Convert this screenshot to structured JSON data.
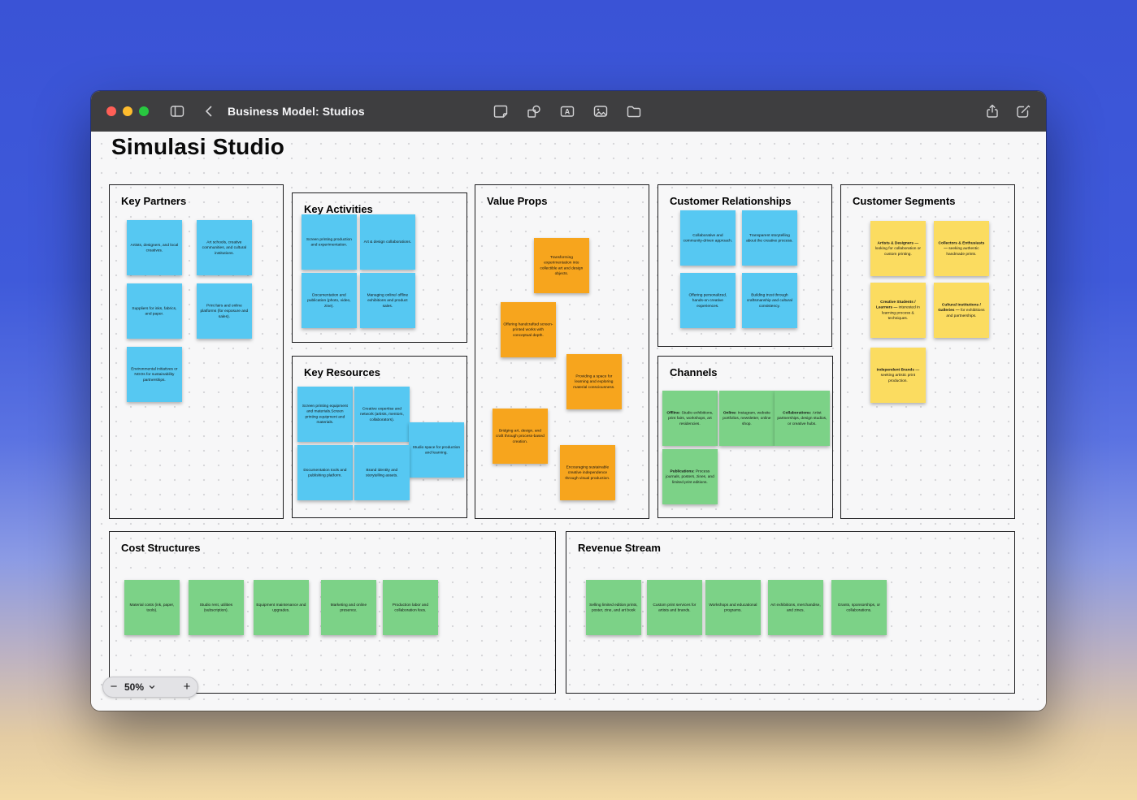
{
  "window": {
    "title": "Business Model: Studios"
  },
  "board": {
    "title": "Simulasi Studio"
  },
  "zoom_control": {
    "decrease_label": "−",
    "level": "50%",
    "increase_label": "+"
  },
  "colors": {
    "note_blue": "#56c8f2",
    "note_orange": "#f7a51d",
    "note_green": "#7cd287",
    "note_yellow": "#fbdc60",
    "traffic_close": "#ff5f57",
    "traffic_min": "#febc2e",
    "traffic_zoom": "#28c840"
  },
  "icons": {
    "zoom_out": "−",
    "zoom_in": "+",
    "zoom_menu_chevron": "⌄"
  },
  "sections": {
    "key_partners": {
      "title": "Key Partners",
      "notes": [
        {
          "color": "blue",
          "text": "Artists, designers, and local creatives."
        },
        {
          "color": "blue",
          "text": "Art schools, creative communities, and cultural institutions."
        },
        {
          "color": "blue",
          "text": "Suppliers for inks, fabrics, and paper."
        },
        {
          "color": "blue",
          "text": "Print fairs and online platforms (for exposure and sales)."
        },
        {
          "color": "blue",
          "text": "Environmental initiatives or NGOs for sustainability partnerships."
        }
      ]
    },
    "key_activities": {
      "title": "Key Activities",
      "notes": [
        {
          "color": "blue",
          "text": "Screen printing production and experimentation."
        },
        {
          "color": "blue",
          "text": "Art & design collaborations."
        },
        {
          "color": "blue",
          "text": "Documentation and publication (photo, video, zine)."
        },
        {
          "color": "blue",
          "text": "Managing online/ offline exhibitions and product sales."
        }
      ]
    },
    "key_resources": {
      "title": "Key Resources",
      "notes": [
        {
          "color": "blue",
          "text": "Screen printing equipment and materials.Screen printing equipment and materials."
        },
        {
          "color": "blue",
          "text": "Creative expertise and network (artists, mentors, collaborators)."
        },
        {
          "color": "blue",
          "text": "Studio space for production and learning."
        },
        {
          "color": "blue",
          "text": "Documentation tools and publishing platform."
        },
        {
          "color": "blue",
          "text": "Brand identity and storytelling assets."
        }
      ]
    },
    "value_props": {
      "title": "Value Props",
      "notes": [
        {
          "color": "orange",
          "text": "Transforming experimentation into collectible art and design objects."
        },
        {
          "color": "orange",
          "text": "Offering handcrafted screen-printed works with conceptual depth."
        },
        {
          "color": "orange",
          "text": "Providing a space for learning and exploring material consciousness."
        },
        {
          "color": "orange",
          "text": "Bridging art, design, and craft through process-based creation."
        },
        {
          "color": "orange",
          "text": "Encouraging sustainable creative independence through visual production."
        }
      ]
    },
    "customer_relationships": {
      "title": "Customer Relationships",
      "notes": [
        {
          "color": "blue",
          "text": "Collaborative and community-driven approach."
        },
        {
          "color": "blue",
          "text": "Transparent storytelling about the creative process."
        },
        {
          "color": "blue",
          "text": "Offering personalized, hands-on creative experiences."
        },
        {
          "color": "blue",
          "text": "Building trust through craftsmanship and cultural consistency."
        }
      ]
    },
    "channels": {
      "title": "Channels",
      "notes": [
        {
          "color": "green",
          "lead": "Offline: ",
          "text": "Studio exhibitions, print fairs, workshops, art residencies."
        },
        {
          "color": "green",
          "lead": "Online: ",
          "text": "Instagram, website portfolios, newsletter, online shop."
        },
        {
          "color": "green",
          "lead": "Collaborations: ",
          "text": "Artist partnerships, design studios, or creative hubs."
        },
        {
          "color": "green",
          "lead": "Publications: ",
          "text": "Process journals, posters, zines, and limited print editions."
        }
      ]
    },
    "customer_segments": {
      "title": "Customer Segments",
      "notes": [
        {
          "color": "yellow",
          "lead": "Artists & Designers — ",
          "text": "looking for collaboration or custom printing."
        },
        {
          "color": "yellow",
          "lead": "Collectors & Enthusiasts — ",
          "text": "seeking authentic handmade prints."
        },
        {
          "color": "yellow",
          "lead": "Creative Students / Learners — ",
          "text": "interested in learning process & techniques."
        },
        {
          "color": "yellow",
          "lead": "Cultural Institutions / Galleries — ",
          "text": "for exhibitions and partnerships."
        },
        {
          "color": "yellow",
          "lead": "Independent Brands — ",
          "text": "seeking artistic print production."
        }
      ]
    },
    "cost_structures": {
      "title": "Cost Structures",
      "notes": [
        {
          "color": "green",
          "text": "Material costs (ink, paper, tools)."
        },
        {
          "color": "green",
          "text": "Studio rent, utilities (subscription)."
        },
        {
          "color": "green",
          "text": "Equipment maintenance and upgrades."
        },
        {
          "color": "green",
          "text": "Marketing and online presence."
        },
        {
          "color": "green",
          "text": "Production labor and collaboration fees."
        }
      ]
    },
    "revenue_stream": {
      "title": "Revenue Stream",
      "notes": [
        {
          "color": "green",
          "text": "Selling limited edition prints, poster, zine, and art book"
        },
        {
          "color": "green",
          "text": "Custom print services for artists and brands."
        },
        {
          "color": "green",
          "text": "Workshops and educational programs."
        },
        {
          "color": "green",
          "text": "Art exhibitions, merchandise, and zines."
        },
        {
          "color": "green",
          "text": "Grants, sponsorships, or collaborations."
        }
      ]
    }
  }
}
